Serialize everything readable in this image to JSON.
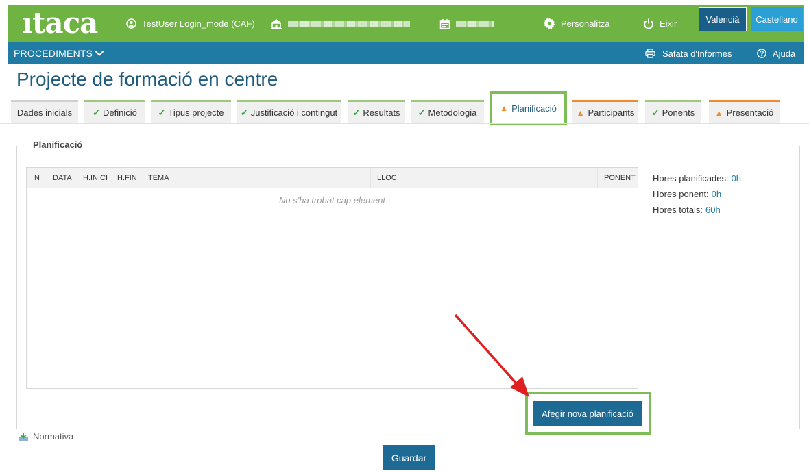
{
  "app": {
    "logo": "ıtaca"
  },
  "topbar": {
    "user_label": "TestUser Login_mode (CAF)",
    "personalitza_label": "Personalitza",
    "eixir_label": "Eixir",
    "lang_valencia": "Valencià",
    "lang_castellano": "Castellano",
    "accent_color": "#6fb342"
  },
  "menubar": {
    "procediments_label": "PROCEDIMENTS",
    "safata_label": "Safata d'Informes",
    "ajuda_label": "Ajuda",
    "color": "#1f7ba4"
  },
  "page": {
    "title": "Projecte de formació en centre"
  },
  "tabs": [
    {
      "label": "Dades inicials",
      "status": "none"
    },
    {
      "label": "Definició",
      "status": "ok"
    },
    {
      "label": "Tipus projecte",
      "status": "ok"
    },
    {
      "label": "Justificació i contingut",
      "status": "ok"
    },
    {
      "label": "Resultats",
      "status": "ok"
    },
    {
      "label": "Metodologia",
      "status": "ok"
    },
    {
      "label": "Planificació",
      "status": "warning",
      "active": true
    },
    {
      "label": "Participants",
      "status": "warning"
    },
    {
      "label": "Ponents",
      "status": "ok"
    },
    {
      "label": "Presentació",
      "status": "warning"
    }
  ],
  "section": {
    "legend": "Planificació",
    "table": {
      "columns": [
        "N",
        "DATA",
        "H.INICI",
        "H.FIN",
        "TEMA",
        "LLOC",
        "PONENT"
      ],
      "empty_message": "No s'ha trobat cap element"
    },
    "summary": {
      "hores_planificades_label": "Hores planificades:",
      "hores_planificades_value": "0h",
      "hores_ponent_label": "Hores ponent:",
      "hores_ponent_value": "0h",
      "hores_totals_label": "Hores totals:",
      "hores_totals_value": "60h"
    },
    "add_button": "Afegir nova planificació"
  },
  "footer": {
    "normativa_label": "Normativa",
    "save_button": "Guardar"
  },
  "highlight_color": "#7dbd55",
  "annotation_arrow_color": "#e02020"
}
